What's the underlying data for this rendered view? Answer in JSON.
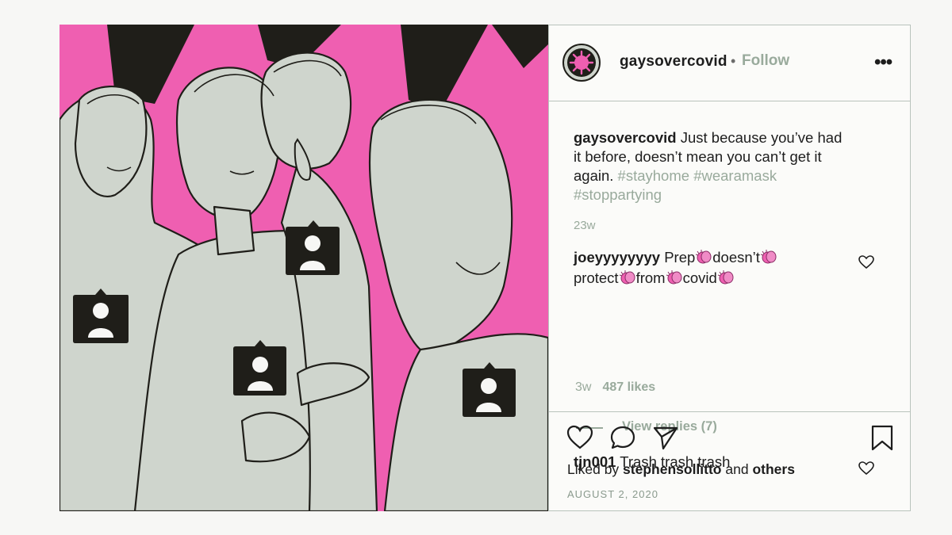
{
  "post": {
    "username": "gaysovercovid",
    "separator": "•",
    "follow_label": "Follow",
    "more_label": "•••",
    "caption_user": "gaysovercovid",
    "caption_text": " Just because you’ve had it before, doesn’t mean you can’t get it again.",
    "hashtags": [
      "#stayhome",
      "#wearamask",
      "#stoppartying"
    ],
    "caption_age": "23w",
    "liked_by_prefix": "Liked by ",
    "liked_by_user": "stephensollitto",
    "liked_by_joiner": " and ",
    "liked_by_others": "others",
    "date": "AUGUST 2, 2020"
  },
  "comments": [
    {
      "user": "joeyyyyyyyy",
      "words": [
        "Prep",
        "doesn’t",
        "protect",
        "from",
        "covid"
      ],
      "age": "3w",
      "likes": "487 likes",
      "view_replies": "View replies (7)"
    },
    {
      "user": "tjn001",
      "text": " Trash trash trash"
    }
  ],
  "icons": {
    "avatar": "virus-avatar-icon",
    "like": "heart-icon",
    "comment": "speech-bubble-icon",
    "share": "paper-plane-icon",
    "save": "bookmark-icon",
    "tag": "user-tag-icon",
    "emoji": "clapping-hands-emoji"
  },
  "colors": {
    "pink": "#ef5fb1",
    "dark": "#1f1e19",
    "skin": "#cfd5cd",
    "muted": "#99aa9c",
    "border": "#b9c3bc"
  }
}
